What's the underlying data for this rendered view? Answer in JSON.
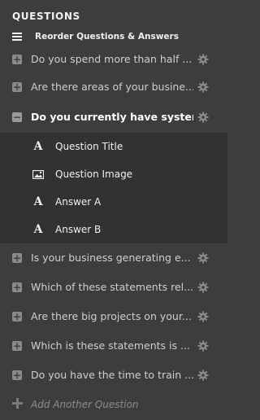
{
  "panel": {
    "title": "QUESTIONS",
    "reorder_label": "Reorder Questions & Answers"
  },
  "questions": [
    {
      "label": "Do you spend more than half ...",
      "expanded": false
    },
    {
      "label": "Are there areas of your busine...",
      "expanded": false
    },
    {
      "label": "Do you currently have system...",
      "expanded": true
    },
    {
      "label": "Is your business generating e...",
      "expanded": false
    },
    {
      "label": "Which of these statements rel...",
      "expanded": false
    },
    {
      "label": "Are there big projects on your...",
      "expanded": false
    },
    {
      "label": "Which is these statements is ...",
      "expanded": false
    },
    {
      "label": "Do you have the time to train ...",
      "expanded": false
    }
  ],
  "sub_items": [
    {
      "label": "Question Title",
      "icon": "text-A-icon"
    },
    {
      "label": "Question Image",
      "icon": "image-icon"
    },
    {
      "label": "Answer A",
      "icon": "text-A-icon"
    },
    {
      "label": "Answer B",
      "icon": "text-A-icon"
    }
  ],
  "add": {
    "label": "Add Another Question"
  },
  "colors": {
    "background": "#3d3d3d",
    "subpanel": "#323232",
    "muted": "#8c8c8c"
  }
}
